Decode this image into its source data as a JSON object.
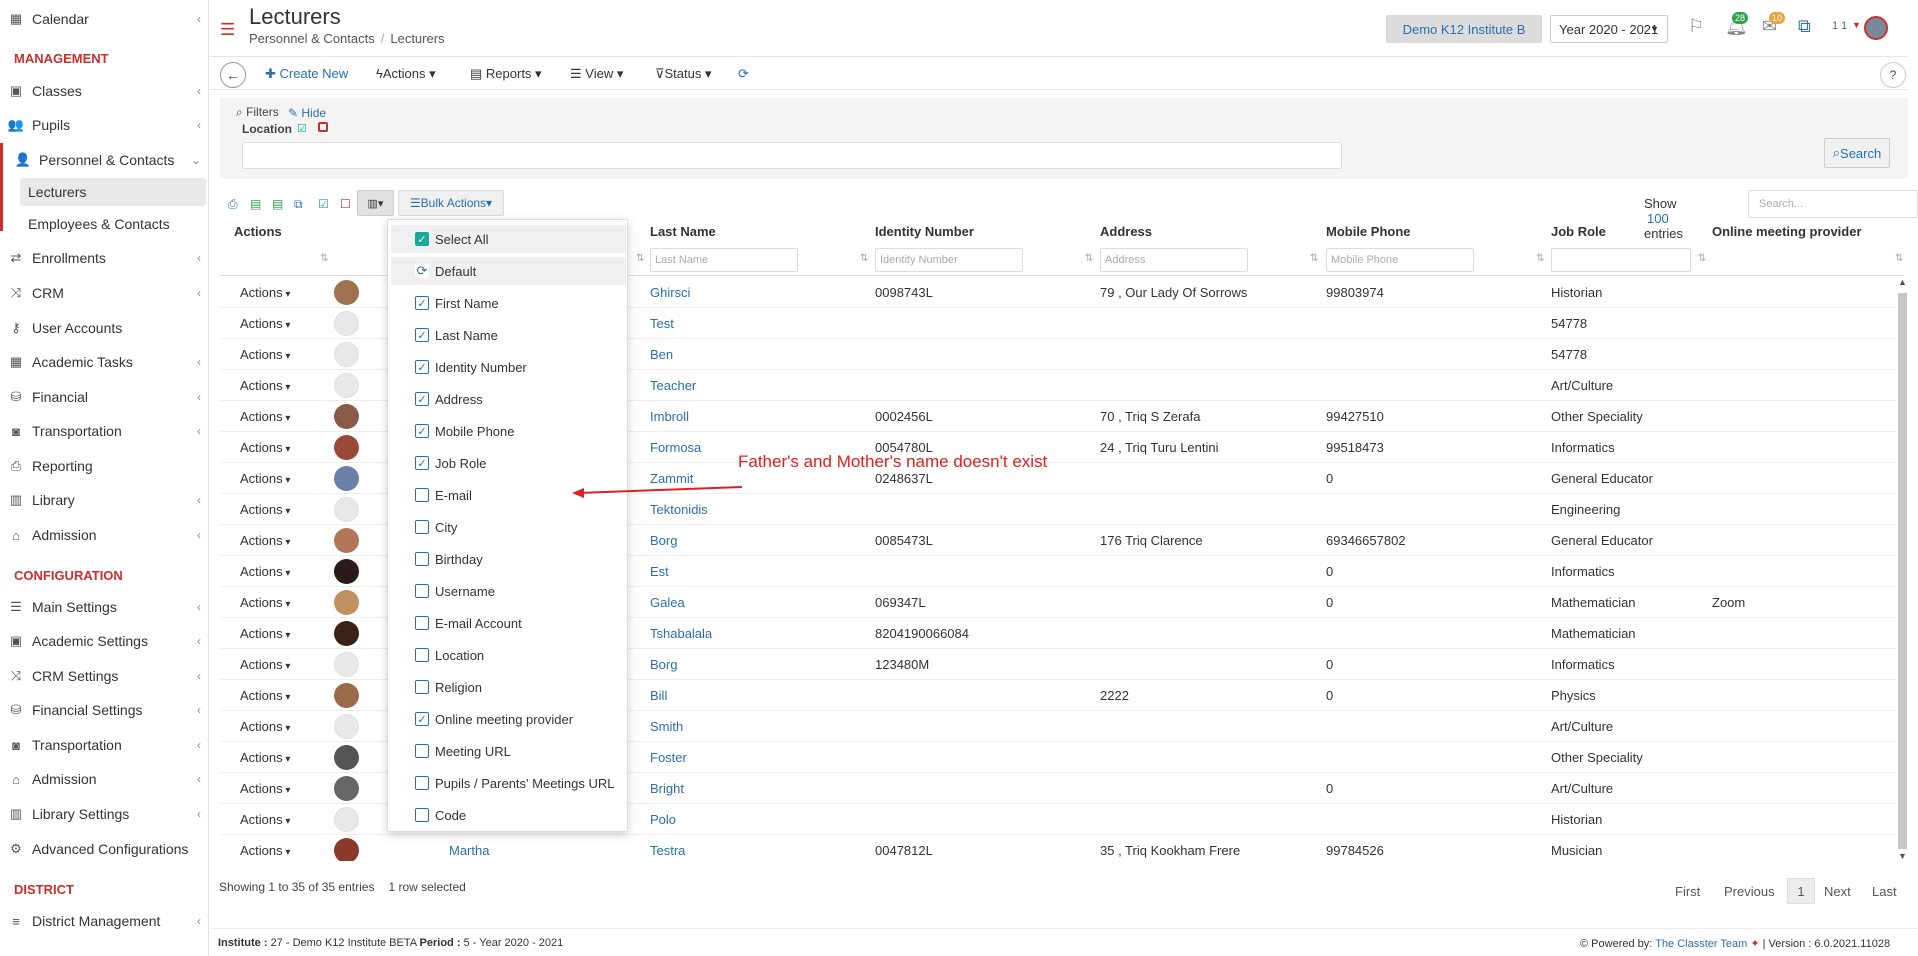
{
  "sidebar": {
    "items": [
      {
        "label": "Calendar",
        "icon": "calendar-icon",
        "chevron": true
      },
      {
        "label": "Classes",
        "icon": "classes-icon",
        "chevron": true
      },
      {
        "label": "Pupils",
        "icon": "pupils-icon",
        "chevron": true
      },
      {
        "label": "Personnel & Contacts",
        "icon": "personnel-icon",
        "chevron": true
      },
      {
        "label": "Enrollments",
        "icon": "enrollments-icon",
        "chevron": true
      },
      {
        "label": "CRM",
        "icon": "crm-icon",
        "chevron": true
      },
      {
        "label": "User Accounts",
        "icon": "key-icon",
        "chevron": false
      },
      {
        "label": "Academic Tasks",
        "icon": "tasks-icon",
        "chevron": true
      },
      {
        "label": "Financial",
        "icon": "coins-icon",
        "chevron": true
      },
      {
        "label": "Transportation",
        "icon": "bus-icon",
        "chevron": true
      },
      {
        "label": "Reporting",
        "icon": "printer-icon",
        "chevron": false
      },
      {
        "label": "Library",
        "icon": "library-icon",
        "chevron": true
      },
      {
        "label": "Admission",
        "icon": "bank-icon",
        "chevron": true
      },
      {
        "label": "Main Settings",
        "icon": "sliders-icon",
        "chevron": true
      },
      {
        "label": "Academic Settings",
        "icon": "classes-icon",
        "chevron": true
      },
      {
        "label": "CRM Settings",
        "icon": "crm-icon",
        "chevron": true
      },
      {
        "label": "Financial Settings",
        "icon": "coins-icon",
        "chevron": true
      },
      {
        "label": "Transportation",
        "icon": "bus-icon",
        "chevron": true
      },
      {
        "label": "Admission",
        "icon": "bank-icon",
        "chevron": true
      },
      {
        "label": "Library Settings",
        "icon": "library-icon",
        "chevron": true
      },
      {
        "label": "Advanced Configurations",
        "icon": "gears-icon",
        "chevron": false
      },
      {
        "label": "District Management",
        "icon": "list-icon",
        "chevron": true
      }
    ],
    "sub_items": [
      {
        "label": "Lecturers",
        "active": true
      },
      {
        "label": "Employees & Contacts",
        "active": false
      }
    ],
    "sections": [
      "MANAGEMENT",
      "CONFIGURATION",
      "DISTRICT"
    ]
  },
  "header": {
    "title": "Lecturers",
    "breadcrumb": [
      "Personnel & Contacts",
      "Lecturers"
    ],
    "institute": "Demo K12 Institute B",
    "year": "Year 2020 - 2021",
    "notif_count": "28",
    "mail_count": "10",
    "user_label": "1 1"
  },
  "toolbar": {
    "create": "Create New",
    "actions": "Actions",
    "reports": "Reports",
    "view": "View",
    "status": "Status"
  },
  "filters": {
    "title": "Filters",
    "hide": "Hide",
    "location_label": "Location",
    "search": "Search"
  },
  "list_controls": {
    "bulk_actions": "Bulk Actions",
    "show": "Show",
    "page_size": "100",
    "entries": "entries",
    "search_placeholder": "Search..."
  },
  "table": {
    "headers": [
      "Actions",
      "Last Name",
      "Identity Number",
      "Address",
      "Mobile Phone",
      "Job Role",
      "Online meeting provider"
    ],
    "filter_placeholders": [
      "Last Name",
      "Identity Number",
      "Address",
      "Mobile Phone",
      ""
    ],
    "action_label": "Actions",
    "rows": [
      {
        "first": "",
        "last": "Ghirsci",
        "id": "0098743L",
        "address": "79 , Our Lady Of Sorrows",
        "mobile": "99803974",
        "role": "Historian",
        "provider": "",
        "avatar": "photo",
        "color": "#a07050"
      },
      {
        "first": "",
        "last": "Test",
        "id": "",
        "address": "",
        "mobile": "",
        "role": "54778",
        "provider": "",
        "avatar": "default",
        "color": "#dcdcdc"
      },
      {
        "first": "",
        "last": "Ben",
        "id": "",
        "address": "",
        "mobile": "",
        "role": "54778",
        "provider": "",
        "avatar": "default",
        "color": "#dcdcdc"
      },
      {
        "first": "",
        "last": "Teacher",
        "id": "",
        "address": "",
        "mobile": "",
        "role": "Art/Culture",
        "provider": "",
        "avatar": "default",
        "color": "#dcdcdc"
      },
      {
        "first": "",
        "last": "Imbroll",
        "id": "0002456L",
        "address": "70 , Triq S Zerafa",
        "mobile": "99427510",
        "role": "Other Speciality",
        "provider": "",
        "avatar": "photo",
        "color": "#8a5a48"
      },
      {
        "first": "",
        "last": "Formosa",
        "id": "0054780L",
        "address": "24 , Triq Turu Lentini",
        "mobile": "99518473",
        "role": "Informatics",
        "provider": "",
        "avatar": "photo",
        "color": "#9a4838"
      },
      {
        "first": "",
        "last": "Zammit",
        "id": "0248637L",
        "address": "",
        "mobile": "0",
        "role": "General Educator",
        "provider": "",
        "avatar": "photo",
        "color": "#6a80a8"
      },
      {
        "first": "",
        "last": "Tektonidis",
        "id": "",
        "address": "",
        "mobile": "",
        "role": "Engineering",
        "provider": "",
        "avatar": "default",
        "color": "#dcdcdc"
      },
      {
        "first": "",
        "last": "Borg",
        "id": "0085473L",
        "address": "176 Triq Clarence",
        "mobile": "69346657802",
        "role": "General Educator",
        "provider": "",
        "avatar": "photo",
        "color": "#b07858"
      },
      {
        "first": "",
        "last": "Est",
        "id": "",
        "address": "",
        "mobile": "0",
        "role": "Informatics",
        "provider": "",
        "avatar": "photo",
        "color": "#2a1a1a"
      },
      {
        "first": "",
        "last": "Galea",
        "id": "069347L",
        "address": "",
        "mobile": "0",
        "role": "Mathematician",
        "provider": "Zoom",
        "avatar": "photo",
        "color": "#c09060"
      },
      {
        "first": "",
        "last": "Tshabalala",
        "id": "8204190066084",
        "address": "",
        "mobile": "",
        "role": "Mathematician",
        "provider": "",
        "avatar": "photo",
        "color": "#3a2218"
      },
      {
        "first": "",
        "last": "Borg",
        "id": "123480M",
        "address": "",
        "mobile": "0",
        "role": "Informatics",
        "provider": "",
        "avatar": "default",
        "color": "#dcdcdc"
      },
      {
        "first": "",
        "last": "Bill",
        "id": "",
        "address": "2222",
        "mobile": "0",
        "role": "Physics",
        "provider": "",
        "avatar": "photo",
        "color": "#9a6a4a"
      },
      {
        "first": "",
        "last": "Smith",
        "id": "",
        "address": "",
        "mobile": "",
        "role": "Art/Culture",
        "provider": "",
        "avatar": "default",
        "color": "#dcdcdc"
      },
      {
        "first": "",
        "last": "Foster",
        "id": "",
        "address": "",
        "mobile": "",
        "role": "Other Speciality",
        "provider": "",
        "avatar": "photo",
        "color": "#555555"
      },
      {
        "first": "",
        "last": "Bright",
        "id": "",
        "address": "",
        "mobile": "0",
        "role": "Art/Culture",
        "provider": "",
        "avatar": "photo",
        "color": "#666666"
      },
      {
        "first": "",
        "last": "Polo",
        "id": "",
        "address": "",
        "mobile": "",
        "role": "Historian",
        "provider": "",
        "avatar": "default",
        "color": "#dcdcdc"
      },
      {
        "first": "Martha",
        "last": "Testra",
        "id": "0047812L",
        "address": "35 , Triq Kookham Frere",
        "mobile": "99784526",
        "role": "Musician",
        "provider": "",
        "avatar": "photo",
        "color": "#8a3a2a"
      }
    ],
    "summary": "Showing 1 to 35 of 35 entries",
    "selected": "1 row selected"
  },
  "pagination": {
    "first": "First",
    "previous": "Previous",
    "current": "1",
    "next": "Next",
    "last": "Last"
  },
  "column_menu": {
    "items": [
      {
        "label": "Select All",
        "type": "select-all",
        "checked": true
      },
      {
        "label": "Default",
        "type": "default",
        "checked": false
      },
      {
        "label": "First Name",
        "type": "check",
        "checked": true
      },
      {
        "label": "Last Name",
        "type": "check",
        "checked": true
      },
      {
        "label": "Identity Number",
        "type": "check",
        "checked": true
      },
      {
        "label": "Address",
        "type": "check",
        "checked": true
      },
      {
        "label": "Mobile Phone",
        "type": "check",
        "checked": true
      },
      {
        "label": "Job Role",
        "type": "check",
        "checked": true
      },
      {
        "label": "E-mail",
        "type": "check",
        "checked": false
      },
      {
        "label": "City",
        "type": "check",
        "checked": false
      },
      {
        "label": "Birthday",
        "type": "check",
        "checked": false
      },
      {
        "label": "Username",
        "type": "check",
        "checked": false
      },
      {
        "label": "E-mail Account",
        "type": "check",
        "checked": false
      },
      {
        "label": "Location",
        "type": "check",
        "checked": false
      },
      {
        "label": "Religion",
        "type": "check",
        "checked": false
      },
      {
        "label": "Online meeting provider",
        "type": "check",
        "checked": true
      },
      {
        "label": "Meeting URL",
        "type": "check",
        "checked": false
      },
      {
        "label": "Pupils / Parents' Meetings URL",
        "type": "check",
        "checked": false
      },
      {
        "label": "Code",
        "type": "check",
        "checked": false
      }
    ]
  },
  "annotation": "Father's and Mother's name doesn't exist",
  "status_bar": {
    "institute_label": "Institute :",
    "institute_value": "27 - Demo K12 Institute BETA",
    "period_label": "Period :",
    "period_value": "5 - Year 2020 - 2021",
    "powered": "Powered by:",
    "team": "The Classter Team",
    "version": "| Version : 6.0.2021.11028"
  },
  "colors": {
    "accent_red": "#c9302c",
    "link_blue": "#2a6fb0",
    "check_green": "#1aa89b",
    "annotation_red": "#e02020"
  }
}
